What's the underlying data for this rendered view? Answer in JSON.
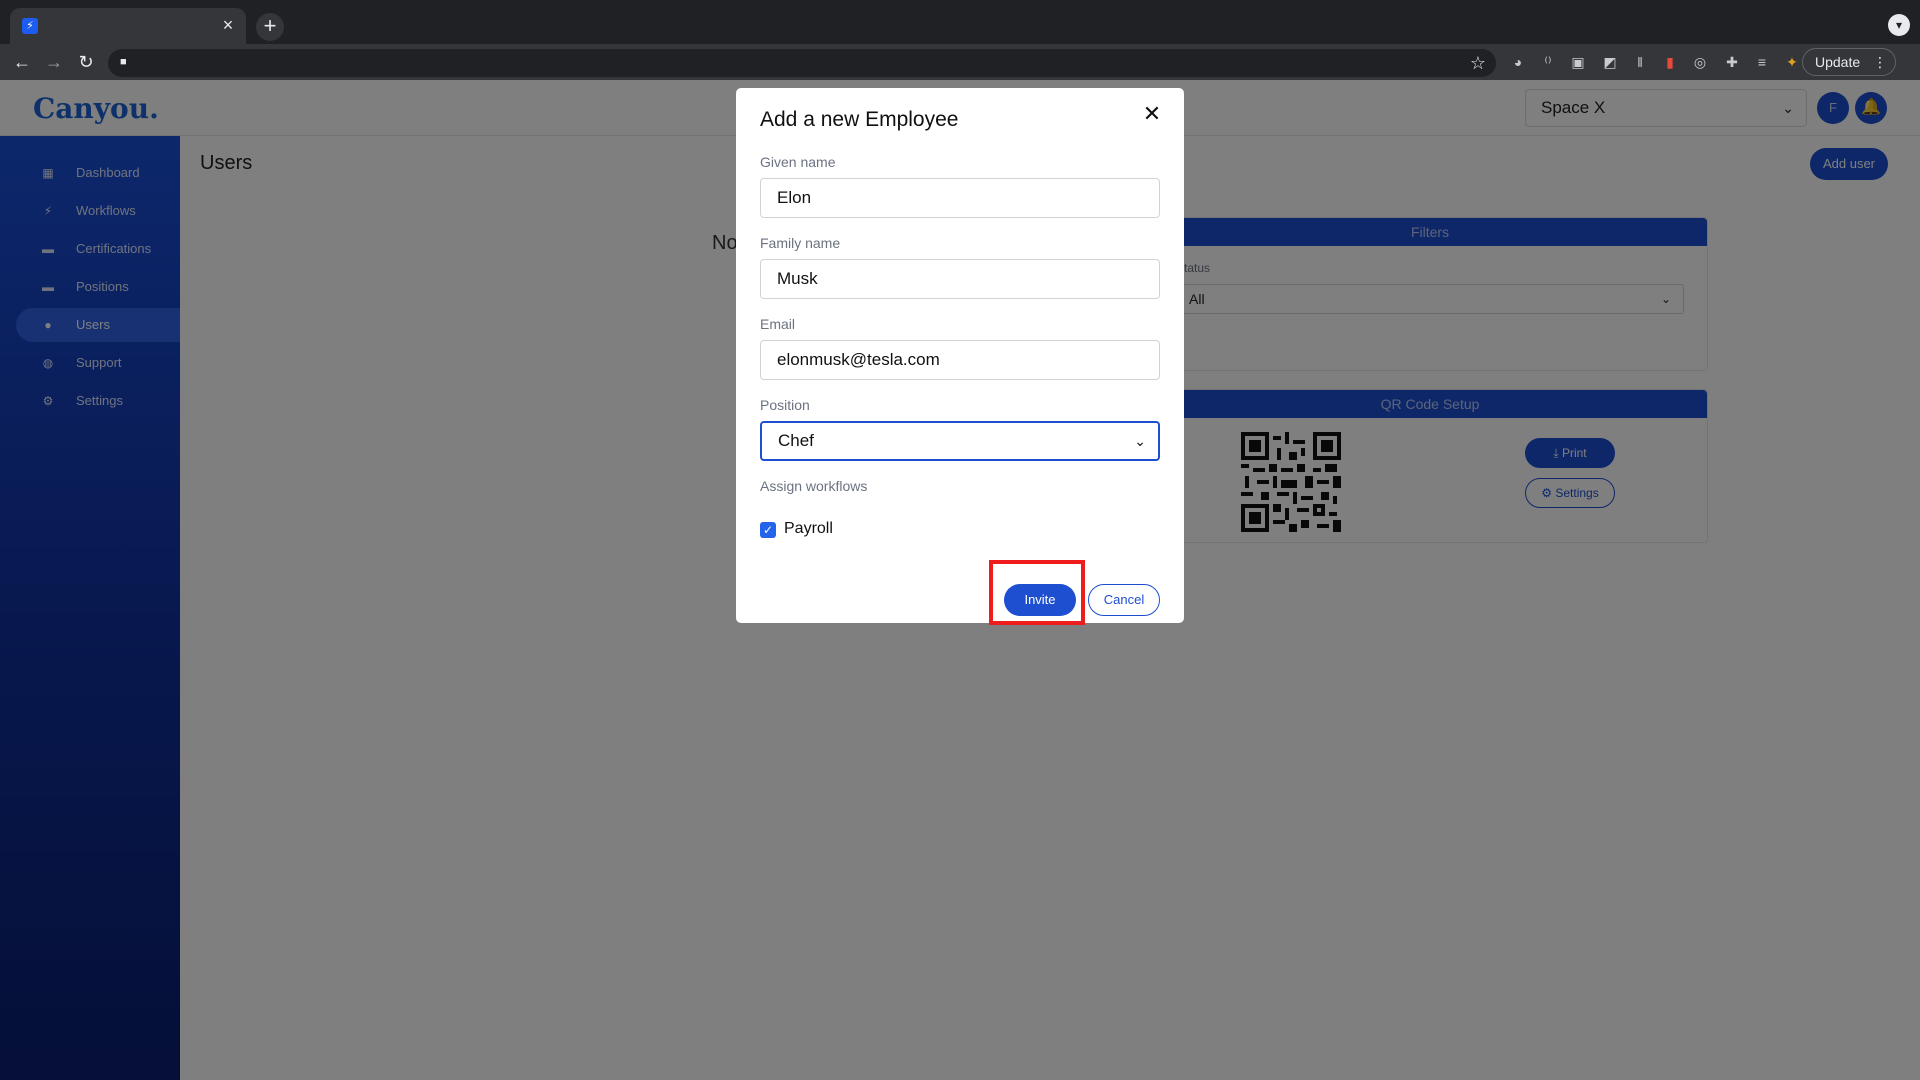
{
  "browser": {
    "tab_close": "×",
    "new_tab": "+",
    "update_label": "Update"
  },
  "app": {
    "logo": "Canyou.",
    "org_select": "Space X",
    "avatar_initial": "F"
  },
  "sidebar": {
    "items": [
      {
        "label": "Dashboard",
        "icon": "dashboard-icon"
      },
      {
        "label": "Workflows",
        "icon": "bolt-icon"
      },
      {
        "label": "Certifications",
        "icon": "briefcase-icon"
      },
      {
        "label": "Positions",
        "icon": "briefcase-icon"
      },
      {
        "label": "Users",
        "icon": "user-icon"
      },
      {
        "label": "Support",
        "icon": "support-icon"
      },
      {
        "label": "Settings",
        "icon": "gear-icon"
      }
    ]
  },
  "main": {
    "title": "Users",
    "partial_text": "No",
    "add_user_label": "Add user",
    "filters": {
      "title": "Filters",
      "status_label": "Status",
      "status_value": "All"
    },
    "qr": {
      "title": "QR Code Setup",
      "print_label": "Print",
      "settings_label": "Settings"
    }
  },
  "modal": {
    "title": "Add a new Employee",
    "given_name_label": "Given name",
    "given_name_value": "Elon",
    "family_name_label": "Family name",
    "family_name_value": "Musk",
    "email_label": "Email",
    "email_value": "elonmusk@tesla.com",
    "position_label": "Position",
    "position_value": "Chef",
    "workflows_label": "Assign workflows",
    "workflow_item": "Payroll",
    "invite_label": "Invite",
    "cancel_label": "Cancel"
  }
}
